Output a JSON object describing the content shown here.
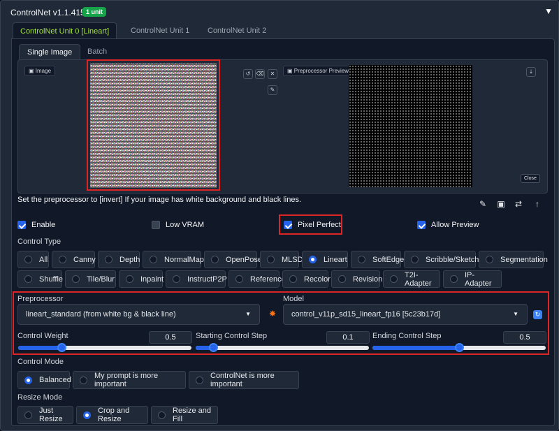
{
  "header": {
    "title": "ControlNet v1.1.415",
    "badge": "1 unit"
  },
  "unit_tabs": [
    "ControlNet Unit 0 [Lineart]",
    "ControlNet Unit 1",
    "ControlNet Unit 2"
  ],
  "image_tabs": [
    "Single Image",
    "Batch"
  ],
  "image_panel": {
    "image_label": "Image",
    "preview_label": "Preprocessor Preview",
    "close_label": "Close"
  },
  "note": "Set the preprocessor to [invert] If your image has white background and black lines.",
  "checkboxes": [
    {
      "label": "Enable",
      "checked": true
    },
    {
      "label": "Low VRAM",
      "checked": false
    },
    {
      "label": "Pixel Perfect",
      "checked": true
    },
    {
      "label": "Allow Preview",
      "checked": true
    }
  ],
  "control_type": {
    "label": "Control Type",
    "row1": [
      "All",
      "Canny",
      "Depth",
      "NormalMap",
      "OpenPose",
      "MLSD",
      "Lineart",
      "SoftEdge",
      "Scribble/Sketch",
      "Segmentation"
    ],
    "row2": [
      "Shuffle",
      "Tile/Blur",
      "Inpaint",
      "InstructP2P",
      "Reference",
      "Recolor",
      "Revision",
      "T2I-Adapter",
      "IP-Adapter"
    ],
    "selected": "Lineart"
  },
  "preprocessor": {
    "label": "Preprocessor",
    "value": "lineart_standard (from white bg & black line)"
  },
  "model": {
    "label": "Model",
    "value": "control_v11p_sd15_lineart_fp16 [5c23b17d]"
  },
  "sliders": [
    {
      "label": "Control Weight",
      "value": "0.5",
      "fraction": 0.25
    },
    {
      "label": "Starting Control Step",
      "value": "0.1",
      "fraction": 0.1
    },
    {
      "label": "Ending Control Step",
      "value": "0.5",
      "fraction": 0.5
    }
  ],
  "control_mode": {
    "label": "Control Mode",
    "options": [
      "Balanced",
      "My prompt is more important",
      "ControlNet is more important"
    ],
    "selected": "Balanced"
  },
  "resize_mode": {
    "label": "Resize Mode",
    "options": [
      "Just Resize",
      "Crop and Resize",
      "Resize and Fill"
    ],
    "selected": "Crop and Resize"
  },
  "colors": {
    "accent": "#2563eb",
    "highlight": "#dc2626",
    "active_tab": "#a3e635",
    "badge": "#16a34a"
  }
}
